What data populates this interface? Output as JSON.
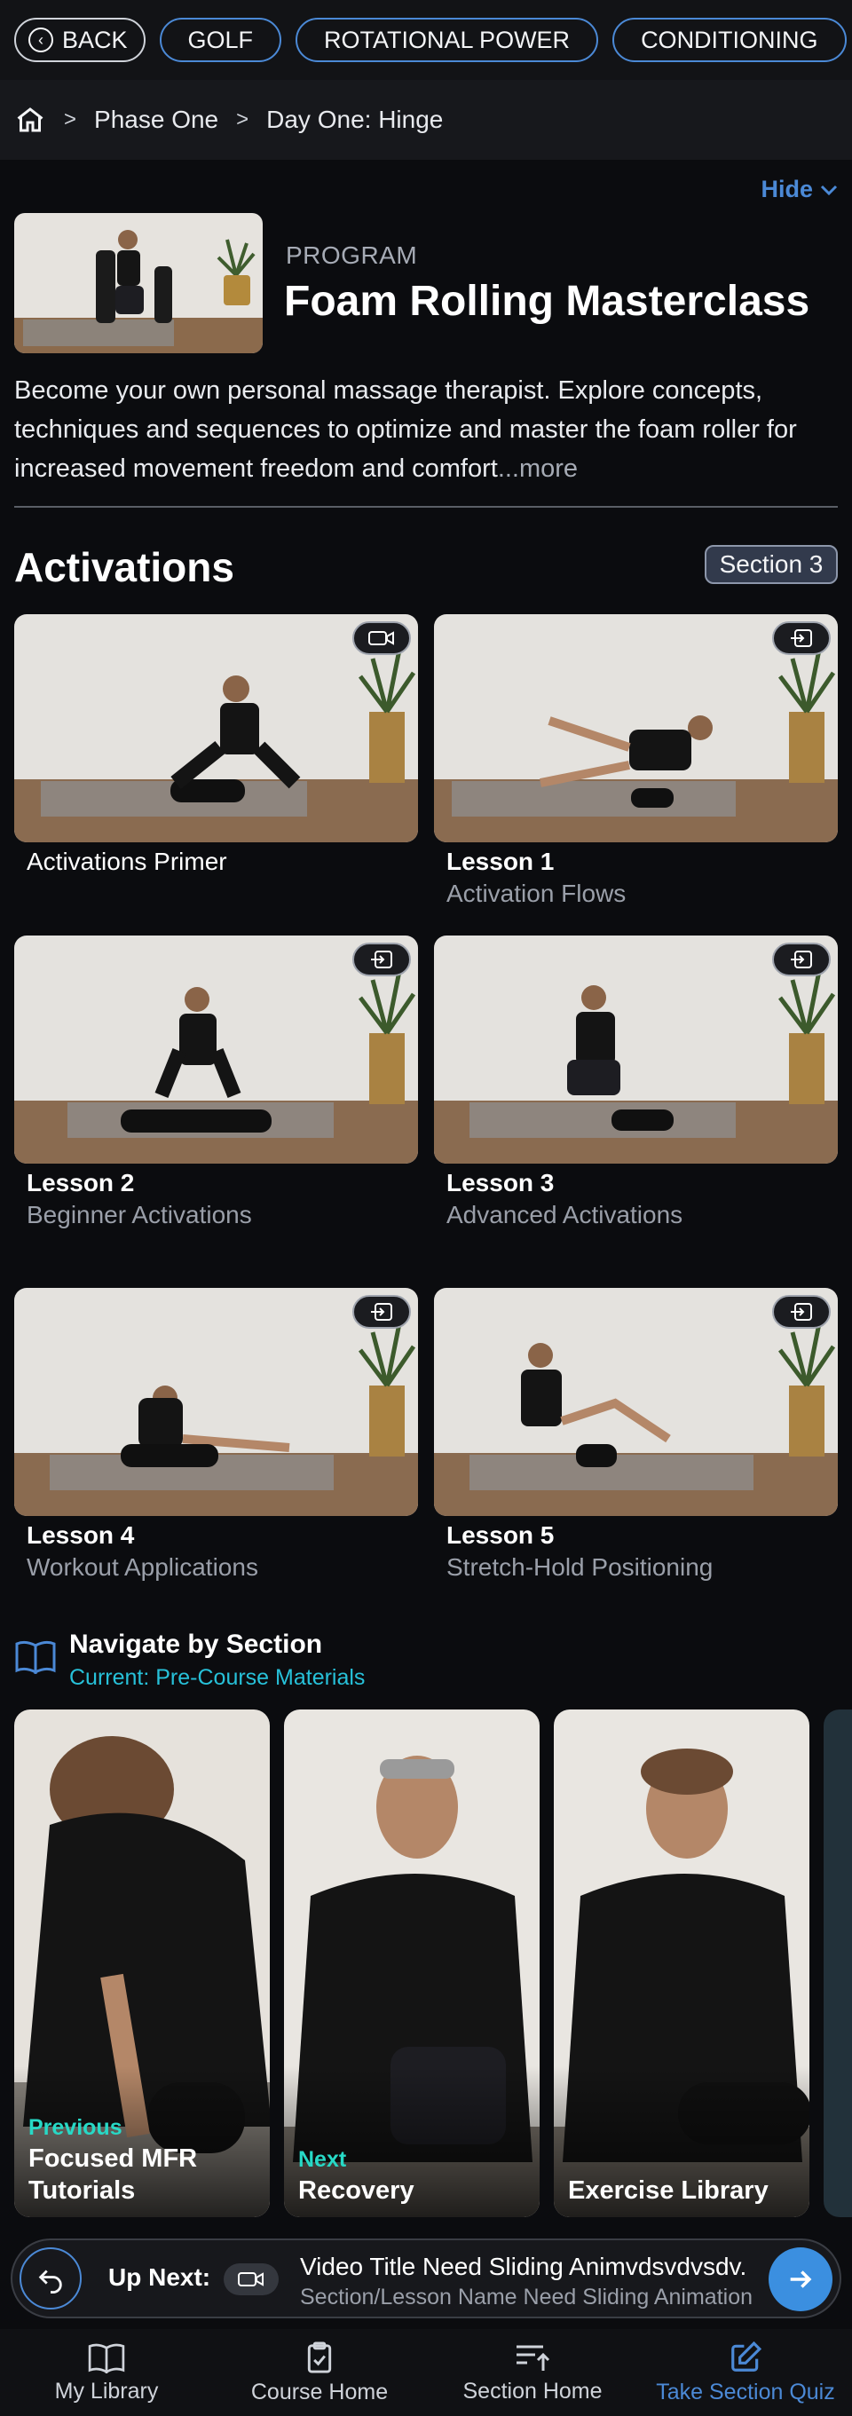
{
  "chips": [
    "BACK",
    "GOLF",
    "ROTATIONAL POWER",
    "CONDITIONING"
  ],
  "breadcrumb": [
    "Phase One",
    "Day One: Hinge"
  ],
  "hide_label": "Hide",
  "program": {
    "label": "PROGRAM",
    "title": "Foam Rolling Masterclass",
    "description": "Become your own personal massage therapist. Explore concepts, techniques and sequences to optimize and master the foam roller for increased movement freedom and comfort",
    "more": "...more"
  },
  "section": {
    "title": "Activations",
    "badge": "Section 3"
  },
  "lessons": [
    {
      "title": "Activations Primer",
      "subtitle": "",
      "icon": "video-icon"
    },
    {
      "title": "Lesson 1",
      "subtitle": "Activation Flows",
      "icon": "enter-icon"
    },
    {
      "title": "Lesson 2",
      "subtitle": "Beginner Activations",
      "icon": "enter-icon"
    },
    {
      "title": "Lesson 3",
      "subtitle": "Advanced Activations",
      "icon": "enter-icon"
    },
    {
      "title": "Lesson 4",
      "subtitle": "Workout Applications",
      "icon": "enter-icon"
    },
    {
      "title": "Lesson 5",
      "subtitle": "Stretch-Hold Positioning",
      "icon": "enter-icon"
    }
  ],
  "navigate": {
    "title": "Navigate by Section",
    "current": "Current: Pre-Course Materials",
    "cards": [
      {
        "tag": "Previous",
        "name_line1": "Focused MFR",
        "name_line2": "Tutorials"
      },
      {
        "tag": "Next",
        "name_line1": "Recovery",
        "name_line2": ""
      },
      {
        "tag": "",
        "name_line1": "Exercise Library",
        "name_line2": ""
      }
    ]
  },
  "up_next": {
    "label": "Up Next:",
    "video_title": "Video Title Need Sliding Animvdsvdvsdv.",
    "section_lesson": "Section/Lesson Name Need Sliding Animation"
  },
  "tabs": [
    {
      "label": "My Library",
      "icon": "book-icon"
    },
    {
      "label": "Course Home",
      "icon": "clipboard-icon"
    },
    {
      "label": "Section Home",
      "icon": "sort-up-icon"
    },
    {
      "label": "Take Section Quiz",
      "icon": "edit-icon",
      "active": true
    }
  ],
  "colors": {
    "accent": "#4b89d6",
    "teal": "#27c1d9",
    "background": "#0b0c0f"
  }
}
